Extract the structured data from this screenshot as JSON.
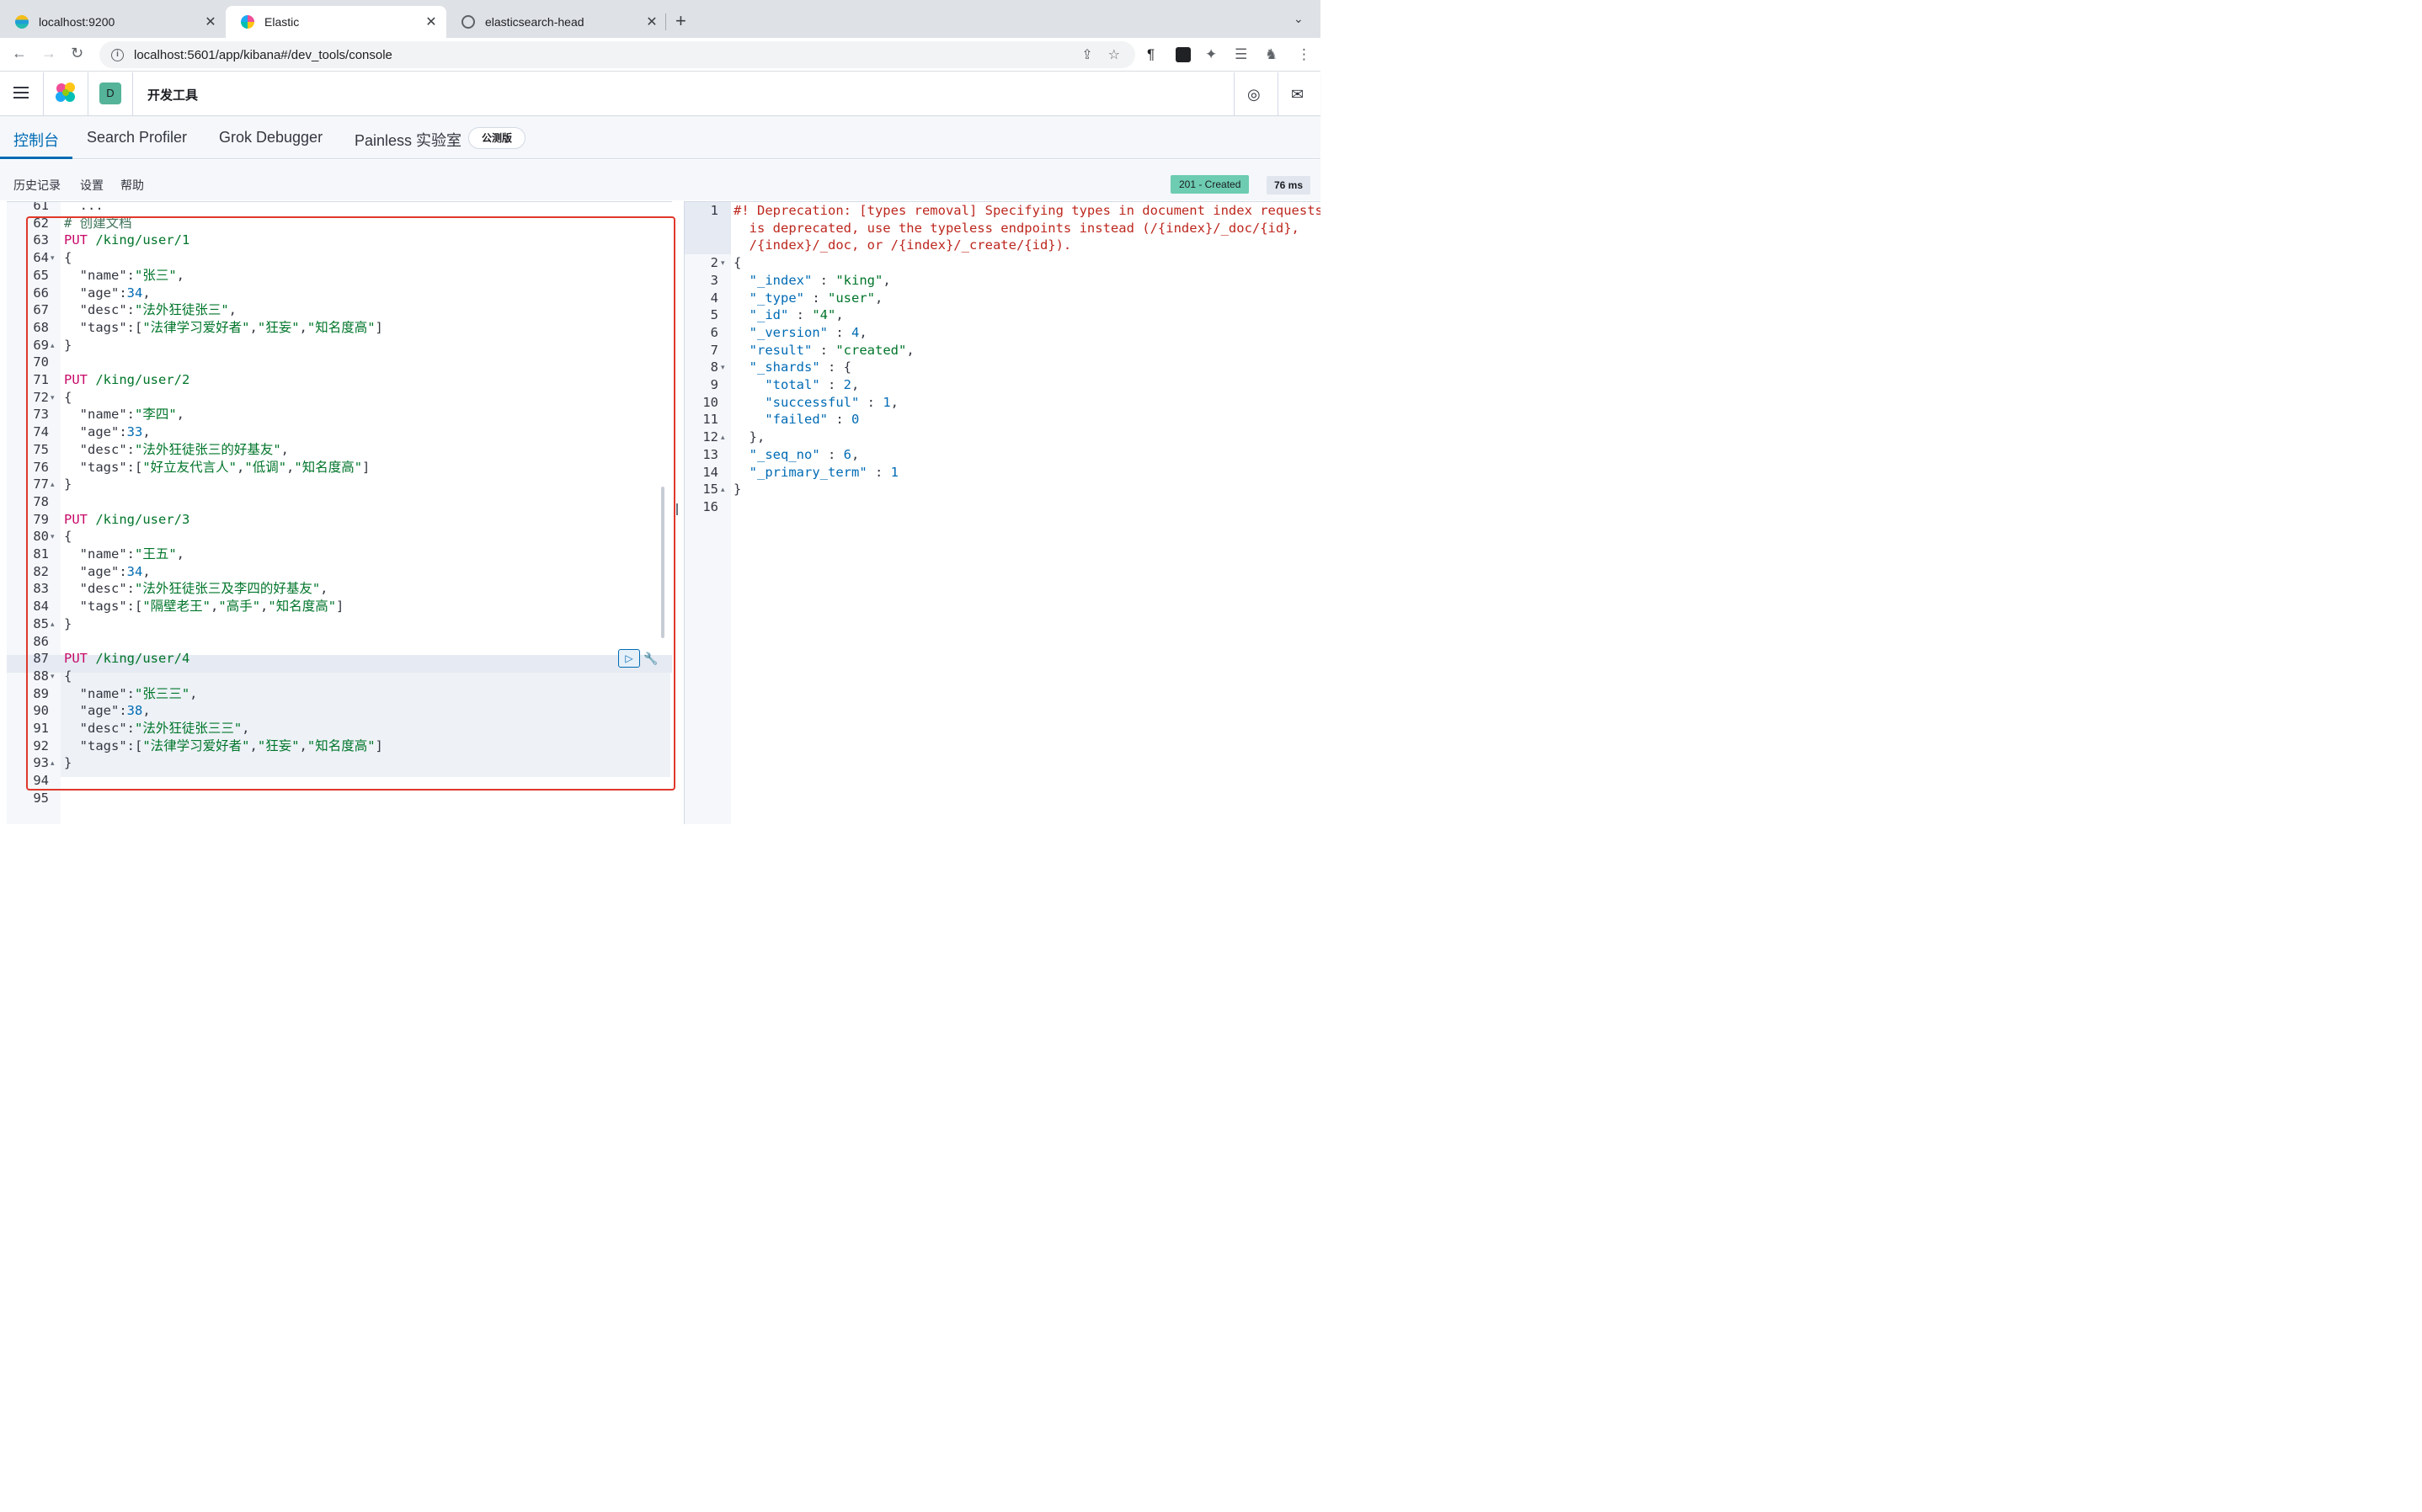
{
  "browser": {
    "tabs": [
      {
        "title": "localhost:9200",
        "active": false
      },
      {
        "title": "Elastic",
        "active": true
      },
      {
        "title": "elasticsearch-head",
        "active": false
      }
    ],
    "url": "localhost:5601/app/kibana#/dev_tools/console"
  },
  "kibana": {
    "space_initial": "D",
    "app_title": "开发工具",
    "tabs": [
      {
        "label": "控制台",
        "active": true
      },
      {
        "label": "Search Profiler"
      },
      {
        "label": "Grok Debugger"
      },
      {
        "label": "Painless 实验室"
      }
    ],
    "beta_label": "公测版",
    "toolbar": {
      "history": "历史记录",
      "settings": "设置",
      "help": "帮助"
    },
    "status": "201 - Created",
    "time": "76 ms"
  },
  "request_lines": [
    {
      "n": "61",
      "text": "  ... ",
      "cut": true
    },
    {
      "n": "62",
      "text": "# 创建文档",
      "type": "comment"
    },
    {
      "n": "63",
      "method": "PUT",
      "path": "/king/user/1"
    },
    {
      "n": "64",
      "text": "{",
      "fold": "down"
    },
    {
      "n": "65",
      "key": "\"name\"",
      "val": "\"张三\"",
      "vtype": "str",
      "tail": ","
    },
    {
      "n": "66",
      "key": "\"age\"",
      "val": "34",
      "vtype": "num",
      "tail": ","
    },
    {
      "n": "67",
      "key": "\"desc\"",
      "val": "\"法外狂徒张三\"",
      "vtype": "str",
      "tail": ","
    },
    {
      "n": "68",
      "key": "\"tags\"",
      "arr": [
        "\"法律学习爱好者\"",
        "\"狂妄\"",
        "\"知名度高\""
      ]
    },
    {
      "n": "69",
      "text": "}",
      "fold": "up"
    },
    {
      "n": "70",
      "text": ""
    },
    {
      "n": "71",
      "method": "PUT",
      "path": "/king/user/2"
    },
    {
      "n": "72",
      "text": "{",
      "fold": "down"
    },
    {
      "n": "73",
      "key": "\"name\"",
      "val": "\"李四\"",
      "vtype": "str",
      "tail": ","
    },
    {
      "n": "74",
      "key": "\"age\"",
      "val": "33",
      "vtype": "num",
      "tail": ","
    },
    {
      "n": "75",
      "key": "\"desc\"",
      "val": "\"法外狂徒张三的好基友\"",
      "vtype": "str",
      "tail": ","
    },
    {
      "n": "76",
      "key": "\"tags\"",
      "arr": [
        "\"好立友代言人\"",
        "\"低调\"",
        "\"知名度高\""
      ]
    },
    {
      "n": "77",
      "text": "}",
      "fold": "up"
    },
    {
      "n": "78",
      "text": ""
    },
    {
      "n": "79",
      "method": "PUT",
      "path": "/king/user/3"
    },
    {
      "n": "80",
      "text": "{",
      "fold": "down"
    },
    {
      "n": "81",
      "key": "\"name\"",
      "val": "\"王五\"",
      "vtype": "str",
      "tail": ","
    },
    {
      "n": "82",
      "key": "\"age\"",
      "val": "34",
      "vtype": "num",
      "tail": ","
    },
    {
      "n": "83",
      "key": "\"desc\"",
      "val": "\"法外狂徒张三及李四的好基友\"",
      "vtype": "str",
      "tail": ","
    },
    {
      "n": "84",
      "key": "\"tags\"",
      "arr": [
        "\"隔壁老王\"",
        "\"高手\"",
        "\"知名度高\""
      ]
    },
    {
      "n": "85",
      "text": "}",
      "fold": "up"
    },
    {
      "n": "86",
      "text": ""
    },
    {
      "n": "87",
      "method": "PUT",
      "path": "/king/user/4",
      "active": true
    },
    {
      "n": "88",
      "text": "{",
      "fold": "down"
    },
    {
      "n": "89",
      "key": "\"name\"",
      "val": "\"张三三\"",
      "vtype": "str",
      "tail": ","
    },
    {
      "n": "90",
      "key": "\"age\"",
      "val": "38",
      "vtype": "num",
      "tail": ","
    },
    {
      "n": "91",
      "key": "\"desc\"",
      "val": "\"法外狂徒张三三\"",
      "vtype": "str",
      "tail": ","
    },
    {
      "n": "92",
      "key": "\"tags\"",
      "arr": [
        "\"法律学习爱好者\"",
        "\"狂妄\"",
        "\"知名度高\""
      ]
    },
    {
      "n": "93",
      "text": "}",
      "fold": "up"
    },
    {
      "n": "94",
      "text": ""
    },
    {
      "n": "95",
      "text": ""
    }
  ],
  "response_lines": [
    {
      "n": "1",
      "warn": "#! Deprecation: [types removal] Specifying types in document index requests"
    },
    {
      "n": "",
      "warn": "  is deprecated, use the typeless endpoints instead (/{index}/_doc/{id},"
    },
    {
      "n": "",
      "warn": "  /{index}/_doc, or /{index}/_create/{id})."
    },
    {
      "n": "2",
      "text": "{",
      "fold": "down"
    },
    {
      "n": "3",
      "key": "\"_index\"",
      "val": "\"king\"",
      "vtype": "str",
      "tail": ",",
      "indent": 1
    },
    {
      "n": "4",
      "key": "\"_type\"",
      "val": "\"user\"",
      "vtype": "str",
      "tail": ",",
      "indent": 1
    },
    {
      "n": "5",
      "key": "\"_id\"",
      "val": "\"4\"",
      "vtype": "str",
      "tail": ",",
      "indent": 1
    },
    {
      "n": "6",
      "key": "\"_version\"",
      "val": "4",
      "vtype": "num",
      "tail": ",",
      "indent": 1
    },
    {
      "n": "7",
      "key": "\"result\"",
      "val": "\"created\"",
      "vtype": "str",
      "tail": ",",
      "indent": 1
    },
    {
      "n": "8",
      "key": "\"_shards\"",
      "val": "{",
      "vtype": "punc",
      "tail": "",
      "indent": 1,
      "fold": "down"
    },
    {
      "n": "9",
      "key": "\"total\"",
      "val": "2",
      "vtype": "num",
      "tail": ",",
      "indent": 2
    },
    {
      "n": "10",
      "key": "\"successful\"",
      "val": "1",
      "vtype": "num",
      "tail": ",",
      "indent": 2
    },
    {
      "n": "11",
      "key": "\"failed\"",
      "val": "0",
      "vtype": "num",
      "tail": "",
      "indent": 2
    },
    {
      "n": "12",
      "text": "  },",
      "fold": "up"
    },
    {
      "n": "13",
      "key": "\"_seq_no\"",
      "val": "6",
      "vtype": "num",
      "tail": ",",
      "indent": 1
    },
    {
      "n": "14",
      "key": "\"_primary_term\"",
      "val": "1",
      "vtype": "num",
      "tail": "",
      "indent": 1
    },
    {
      "n": "15",
      "text": "}",
      "fold": "up"
    },
    {
      "n": "16",
      "text": ""
    }
  ]
}
